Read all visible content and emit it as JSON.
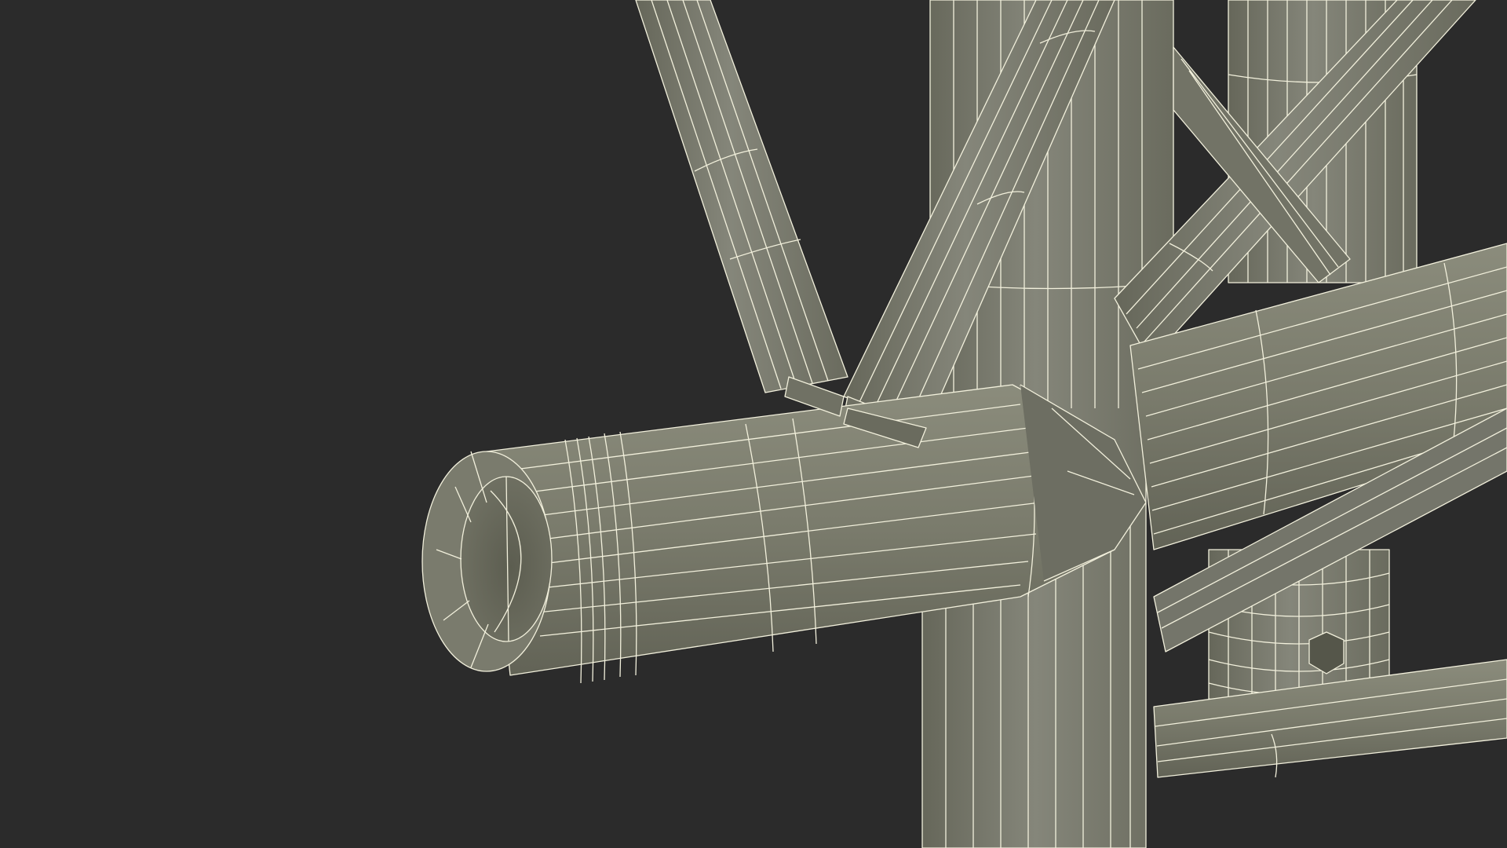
{
  "scene": {
    "subject": "truss-joint-wireframe",
    "background_color": "#2b2b2b",
    "metal_color": "#7c7d6d",
    "metal_shadow_color": "#5e5f52",
    "metal_highlight_color": "#8e8f7e",
    "wire_color": "#f2f0dc"
  }
}
